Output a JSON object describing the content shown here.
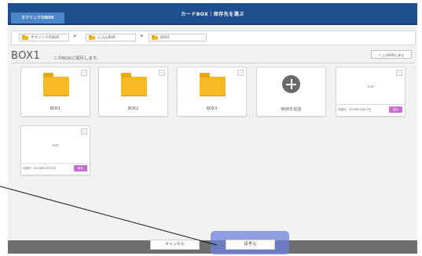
{
  "header": {
    "tab_label": "オクリンクのBOX",
    "title": "カードBOX｜保存先を選ぶ"
  },
  "breadcrumb": {
    "items": [
      {
        "label": "オクリンクのBOX"
      },
      {
        "label": "じぶんBOX"
      },
      {
        "label": "BOX1"
      }
    ],
    "separator": "▶"
  },
  "main": {
    "title": "BOX1",
    "subtitle": "このBOXに保存します。",
    "up_button_label": "上のBOXに戻る"
  },
  "folders": [
    {
      "label": "BOX1",
      "icon": "folder-icon"
    },
    {
      "label": "BOX2",
      "icon": "folder-icon"
    },
    {
      "label": "BOX3",
      "icon": "folder-icon"
    }
  ],
  "add_card": {
    "label": "BOXを追加",
    "icon": "plus-circle-icon"
  },
  "text_cards": [
    {
      "text": "text",
      "update_date": "利用日：2019年02月15日",
      "open_label": "表示"
    },
    {
      "text": "text",
      "update_date": "利用日：2019年02月15日",
      "open_label": "表示"
    }
  ],
  "footer": {
    "cancel_label": "キャンセル",
    "save_label": "ほぞん"
  },
  "colors": {
    "header_bg": "#1f4f8f",
    "tab_bg": "#4a86c8",
    "folder": "#f7b924",
    "open_button": "#c86ad0",
    "footer_bg": "#6e6e6e",
    "highlight": "#6e82dc"
  }
}
